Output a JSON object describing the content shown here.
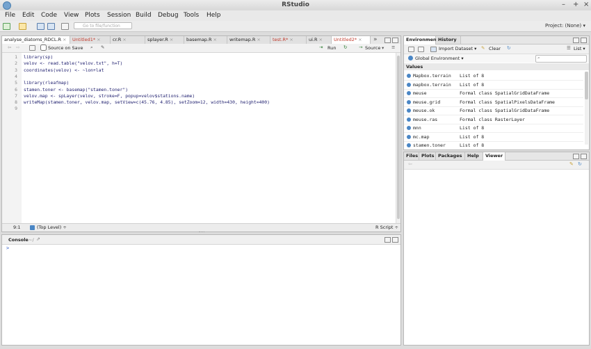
{
  "window": {
    "title": "RStudio",
    "controls": [
      "–",
      "+",
      "×"
    ]
  },
  "menu": [
    "File",
    "Edit",
    "Code",
    "View",
    "Plots",
    "Session",
    "Build",
    "Debug",
    "Tools",
    "Help"
  ],
  "toolbar": {
    "goto_placeholder": "Go to file/function",
    "project": "Project: (None) ▾"
  },
  "editor": {
    "tabs": [
      {
        "label": "analyse_diatoms_RDCL.R",
        "modified": false
      },
      {
        "label": "Untitled1*",
        "modified": true
      },
      {
        "label": "cr.R",
        "modified": false
      },
      {
        "label": "splayer.R",
        "modified": false
      },
      {
        "label": "basemap.R",
        "modified": false
      },
      {
        "label": "writemap.R",
        "modified": false
      },
      {
        "label": "test.R*",
        "modified": true
      },
      {
        "label": "ui.R",
        "modified": false
      },
      {
        "label": "Untitled2*",
        "modified": true
      }
    ],
    "close_glyph": "×",
    "overflow": "»",
    "source_on_save": "Source on Save",
    "run": "Run",
    "source": "Source",
    "lines": [
      {
        "n": "1",
        "t": "library(sp)"
      },
      {
        "n": "2",
        "t": "velov <- read.table(\"velov.txt\", h=T)"
      },
      {
        "n": "3",
        "t": "coordinates(velov) <- ~lon+lat"
      },
      {
        "n": "4",
        "t": ""
      },
      {
        "n": "5",
        "t": "library(rleafmap)"
      },
      {
        "n": "6",
        "t": "stamen.toner <- basemap(\"stamen.toner\")"
      },
      {
        "n": "7",
        "t": "velov.map <- spLayer(velov, stroke=F, popup=velov$stations.name)"
      },
      {
        "n": "8",
        "t": "writeMap(stamen.toner, velov.map, setView=c(45.76, 4.85), setZoom=12, width=430, height=400)"
      },
      {
        "n": "9",
        "t": ""
      }
    ],
    "status_pos": "9:1",
    "status_level": "(Top Level) ÷",
    "status_type": "R Script ÷"
  },
  "console": {
    "title": "Console",
    "path": "~/",
    "prompt": ">"
  },
  "env": {
    "tabs": [
      "Environment",
      "History"
    ],
    "import": "Import Dataset ▾",
    "clear": "Clear",
    "list": "List ▾",
    "scope": "Global Environment ▾",
    "section": "Values",
    "rows": [
      {
        "name": "Mapbox.terrain",
        "value": "List of 8"
      },
      {
        "name": "mapbox.terrain",
        "value": "List of 8"
      },
      {
        "name": "meuse",
        "value": "Formal class SpatialGridDataFrame"
      },
      {
        "name": "meuse.grid",
        "value": "Formal class SpatialPixelsDataFrame"
      },
      {
        "name": "meuse.ok",
        "value": "Formal class SpatialGridDataFrame"
      },
      {
        "name": "meuse.ras",
        "value": "Formal class RasterLayer"
      },
      {
        "name": "mnn",
        "value": "List of 8"
      },
      {
        "name": "mc.map",
        "value": "List of 8"
      },
      {
        "name": "stamen.toner",
        "value": "List of 8"
      }
    ]
  },
  "files": {
    "tabs": [
      "Files",
      "Plots",
      "Packages",
      "Help",
      "Viewer"
    ]
  }
}
